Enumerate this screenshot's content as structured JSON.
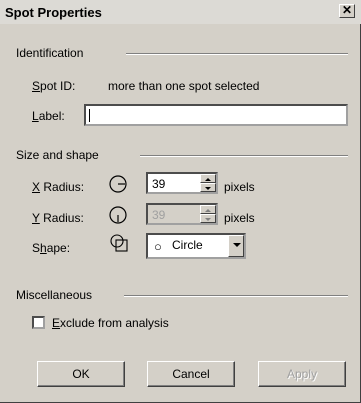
{
  "dialog": {
    "title": "Spot Properties",
    "close_glyph": "✕"
  },
  "identification": {
    "group_label": "Identification",
    "spot_id_label_u": "S",
    "spot_id_label_rest": "pot ID:",
    "spot_id_value": "more than one spot selected",
    "label_label_u": "L",
    "label_label_rest": "abel:",
    "label_value": ""
  },
  "size_shape": {
    "group_label": "Size and shape",
    "x_radius_label_u": "X",
    "x_radius_label_rest": " Radius:",
    "x_radius_value": "39",
    "x_radius_unit": "pixels",
    "y_radius_label_u": "Y",
    "y_radius_label_rest": " Radius:",
    "y_radius_value": "39",
    "y_radius_unit": "pixels",
    "y_radius_enabled": false,
    "shape_label_pre": "S",
    "shape_label_u": "h",
    "shape_label_rest": "ape:",
    "shape_selected": "Circle",
    "shape_glyph": "○"
  },
  "misc": {
    "group_label": "Miscellaneous",
    "exclude_label_u": "E",
    "exclude_label_rest": "xclude from analysis",
    "exclude_checked": false
  },
  "buttons": {
    "ok": "OK",
    "cancel": "Cancel",
    "apply": "Apply",
    "apply_enabled": false
  },
  "icons": [
    "x-radius-icon",
    "y-radius-icon",
    "shape-icon",
    "close-icon",
    "spin-up-icon",
    "spin-down-icon",
    "dropdown-arrow-icon"
  ]
}
